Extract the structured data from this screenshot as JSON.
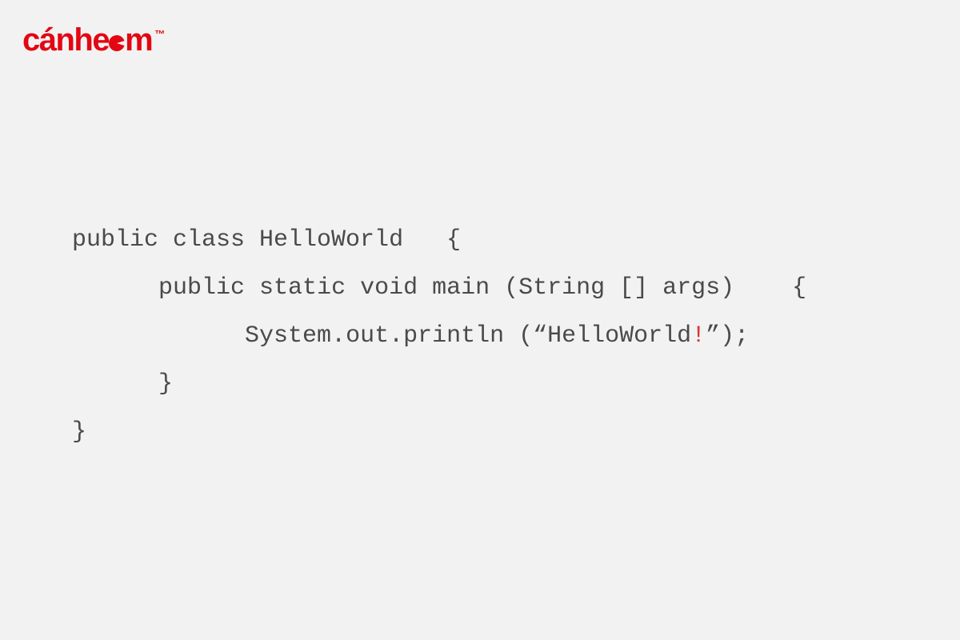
{
  "logo": {
    "text_before_icon": "cánhe",
    "text_after_icon": "m",
    "trademark": "™",
    "color": "#e30613"
  },
  "code": {
    "line1": "public class HelloWorld   {",
    "line2_indent": "      ",
    "line2": "public static void main (String [] args)    {",
    "line3_indent": "            ",
    "line3a": "System.out.println (“HelloWorld",
    "line3_exclaim": "!",
    "line3b": "”);",
    "line4_indent": "      ",
    "line4": "}",
    "line5": "}"
  }
}
